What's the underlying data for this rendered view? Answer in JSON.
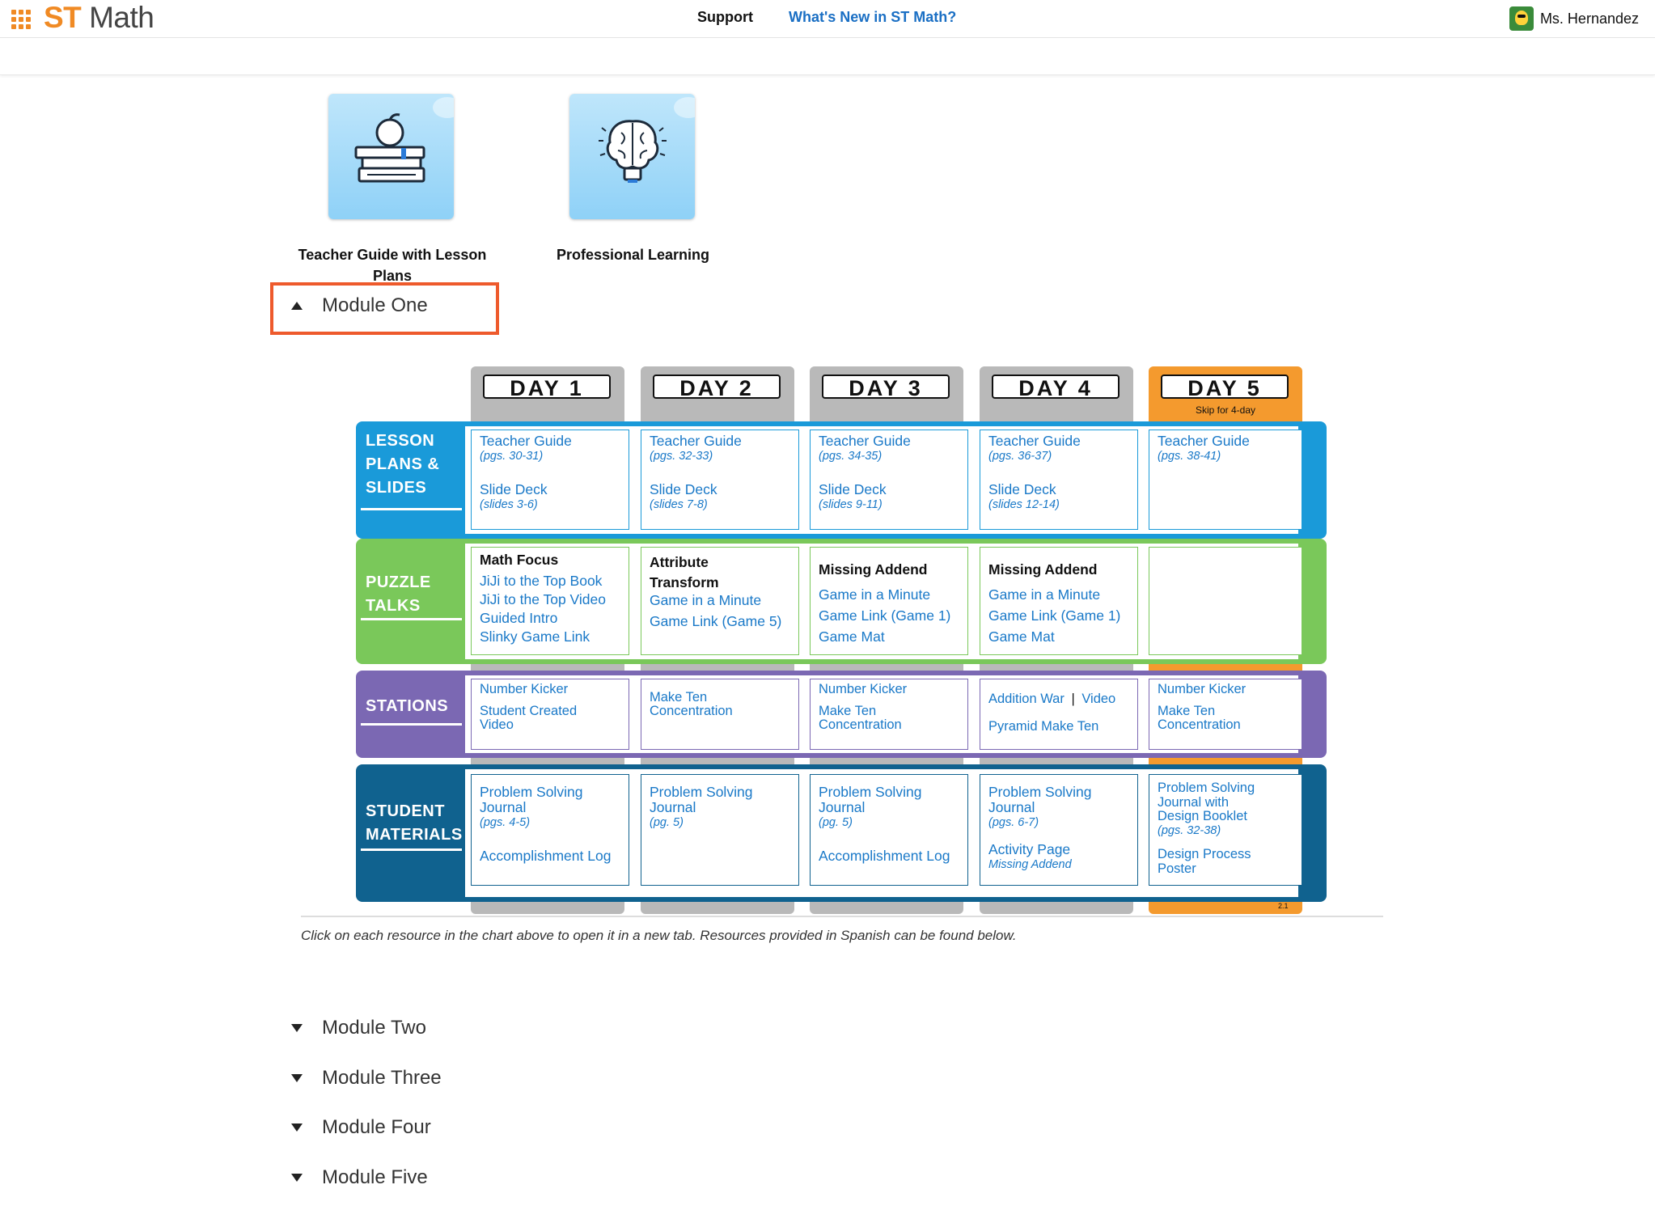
{
  "header": {
    "logo_st": "ST",
    "logo_math": "Math",
    "support": "Support",
    "whats_new": "What's New in ST Math?",
    "user_name": "Ms. Hernandez"
  },
  "resources": [
    {
      "label": "Teacher Guide with Lesson Plans",
      "icon": "books-apple-icon"
    },
    {
      "label": "Professional Learning",
      "icon": "brain-lightbulb-icon"
    }
  ],
  "modules": {
    "one": "Module One",
    "two": "Module Two",
    "three": "Module Three",
    "four": "Module Four",
    "five": "Module Five"
  },
  "chart": {
    "days": [
      "DAY 1",
      "DAY 2",
      "DAY 3",
      "DAY 4",
      "DAY 5"
    ],
    "day5_note": "Skip for 4-day",
    "rows": {
      "lesson": "LESSON PLANS & SLIDES",
      "puzzle": "PUZZLE TALKS",
      "stations": "STATIONS",
      "student": "STUDENT MATERIALS"
    },
    "lesson": {
      "tg": "Teacher Guide",
      "sd": "Slide Deck",
      "d1_pg": "(pgs. 30-31)",
      "d1_sl": "(slides 3-6)",
      "d2_pg": "(pgs. 32-33)",
      "d2_sl": "(slides 7-8)",
      "d3_pg": "(pgs. 34-35)",
      "d3_sl": "(slides 9-11)",
      "d4_pg": "(pgs. 36-37)",
      "d4_sl": "(slides 12-14)",
      "d5_pg": "(pgs. 38-41)"
    },
    "puzzle": {
      "d1_head": "Math Focus",
      "d1_links": [
        "JiJi to the Top Book",
        "JiJi to the Top Video",
        "Guided Intro",
        "Slinky Game Link"
      ],
      "d2_head": "Attribute Transform",
      "d2_links": [
        "Game in a Minute",
        "Game Link (Game 5)"
      ],
      "d3_head": "Missing Addend",
      "d3_links": [
        "Game in a Minute",
        "Game Link (Game 1)",
        "Game Mat"
      ],
      "d4_head": "Missing Addend",
      "d4_links": [
        "Game in a Minute",
        "Game Link (Game 1)",
        "Game Mat"
      ]
    },
    "stations": {
      "d1": [
        "Number Kicker",
        "Student Created Video"
      ],
      "d2": [
        "Make Ten Concentration"
      ],
      "d3": [
        "Number Kicker",
        "Make Ten Concentration"
      ],
      "d4_a": "Addition War",
      "d4_sep": "|",
      "d4_b": "Video",
      "d4_c": "Pyramid Make Ten",
      "d5": [
        "Number Kicker",
        "Make Ten Concentration"
      ]
    },
    "student": {
      "psj": "Problem Solving Journal",
      "acc": "Accomplishment Log",
      "d1_pg": "(pgs. 4-5)",
      "d2_pg": "(pg. 5)",
      "d3_pg": "(pg. 5)",
      "d4_pg": "(pgs. 6-7)",
      "d4_act": "Activity Page",
      "d4_act_sub": "Missing Addend",
      "d5_psj": "Problem Solving Journal with Design Booklet",
      "d5_pg": "(pgs. 32-38)",
      "d5_poster": "Design Process Poster"
    },
    "version": "2.1"
  },
  "footnote": "Click on each resource in the chart above to open it in a new tab. Resources provided in Spanish can be found below.",
  "colors": {
    "brand_orange": "#f08a24",
    "lesson_blue": "#1a9ad9",
    "puzzle_green": "#7ac85a",
    "stations_purple": "#7b68b3",
    "student_navy": "#10628f",
    "highlight": "#ee5a2c"
  }
}
